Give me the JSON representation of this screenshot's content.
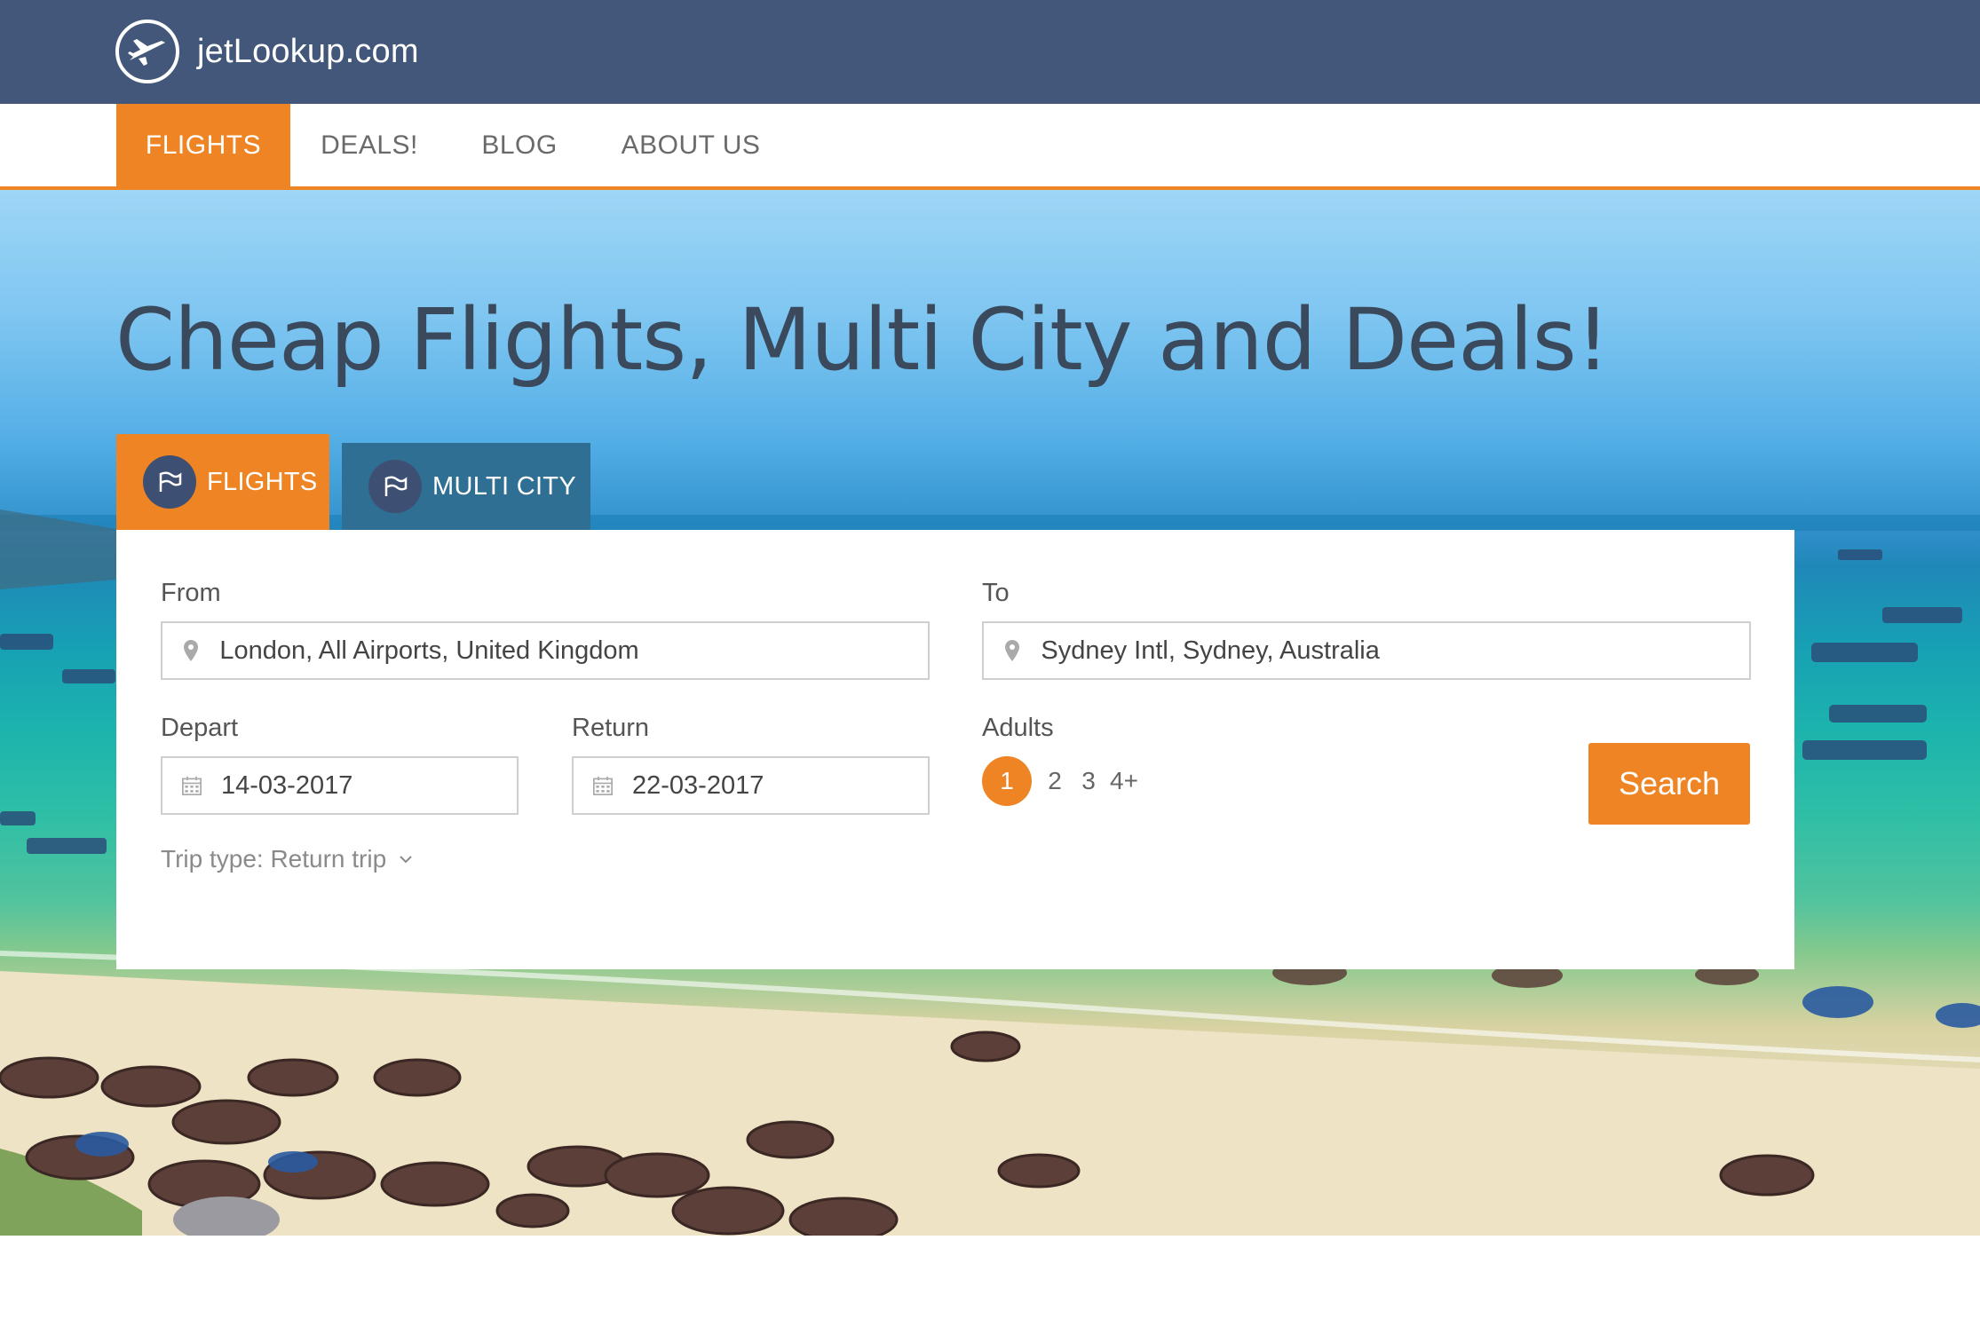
{
  "brand": {
    "name": "jetLookup.com"
  },
  "nav": {
    "items": [
      {
        "label": "FLIGHTS",
        "active": true
      },
      {
        "label": "DEALS!",
        "active": false
      },
      {
        "label": "BLOG",
        "active": false
      },
      {
        "label": "ABOUT US",
        "active": false
      }
    ]
  },
  "hero": {
    "title": "Cheap Flights, Multi City and Deals!"
  },
  "search_tabs": [
    {
      "label": "FLIGHTS",
      "active": true,
      "icon": "flag-icon"
    },
    {
      "label": "MULTI CITY",
      "active": false,
      "icon": "flag-icon"
    }
  ],
  "search_form": {
    "from_label": "From",
    "from_value": "London, All Airports, United Kingdom",
    "to_label": "To",
    "to_value": "Sydney Intl, Sydney, Australia",
    "depart_label": "Depart",
    "depart_value": "14-03-2017",
    "return_label": "Return",
    "return_value": "22-03-2017",
    "adults_label": "Adults",
    "adults_options": [
      "1",
      "2",
      "3",
      "4+"
    ],
    "adults_selected": "1",
    "search_button": "Search",
    "trip_type": "Trip type: Return trip"
  },
  "colors": {
    "header_bg": "#42577a",
    "accent": "#ee8424",
    "secondary_tab": "#2f6f93",
    "title_text": "#3a4a5c"
  }
}
